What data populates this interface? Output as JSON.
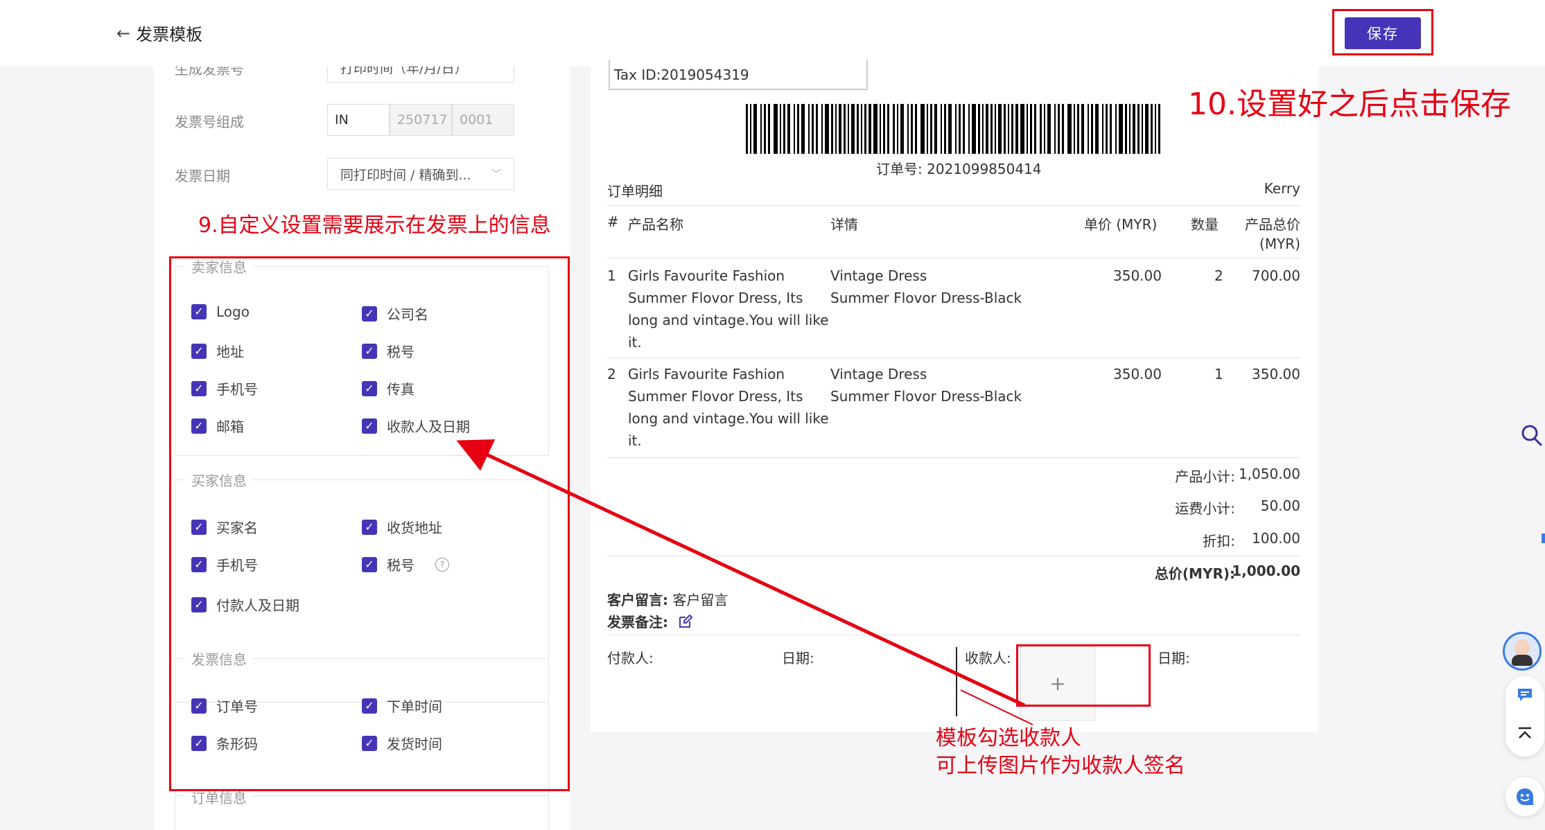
{
  "header": {
    "back_title": "发票模板",
    "save_label": "保存"
  },
  "left_panel": {
    "partial_top_label": "生成发票号",
    "partial_top_select": "打印时间（年/月/日）",
    "invoice_number_label": "发票号组成",
    "invoice_number_prefix": "IN",
    "invoice_number_date": "250717",
    "invoice_number_seq": "0001",
    "invoice_date_label": "发票日期",
    "invoice_date_select": "同打印时间 / 精确到...",
    "groups": [
      {
        "title": "卖家信息",
        "items": [
          {
            "label": "Logo",
            "checked": true
          },
          {
            "label": "公司名",
            "checked": true
          },
          {
            "label": "地址",
            "checked": true
          },
          {
            "label": "税号",
            "checked": true
          },
          {
            "label": "手机号",
            "checked": true
          },
          {
            "label": "传真",
            "checked": true
          },
          {
            "label": "邮箱",
            "checked": true
          },
          {
            "label": "收款人及日期",
            "checked": true
          }
        ]
      },
      {
        "title": "买家信息",
        "items": [
          {
            "label": "买家名",
            "checked": true
          },
          {
            "label": "收货地址",
            "checked": true
          },
          {
            "label": "手机号",
            "checked": true
          },
          {
            "label": "税号",
            "checked": true
          },
          {
            "label": "付款人及日期",
            "checked": true
          }
        ]
      },
      {
        "title": "发票信息",
        "items": [
          {
            "label": "订单号",
            "checked": true
          },
          {
            "label": "下单时间",
            "checked": true
          },
          {
            "label": "条形码",
            "checked": true
          },
          {
            "label": "发货时间",
            "checked": true
          }
        ]
      },
      {
        "title": "订单信息",
        "items": []
      }
    ]
  },
  "annotations": {
    "step9": "9.自定义设置需要展示在发票上的信息",
    "step10": "10.设置好之后点击保存",
    "payee_line1": "模板勾选收款人",
    "payee_line2": "可上传图片作为收款人签名"
  },
  "invoice": {
    "tax_id": "Tax ID:2019054319",
    "order_no": "订单号: 2021099850414",
    "section_title": "订单明细",
    "buyer_name": "Kerry",
    "columns": [
      "#",
      "产品名称",
      "详情",
      "单价 (MYR)",
      "数量",
      "产品总价",
      "(MYR)"
    ],
    "rows": [
      {
        "index": "1",
        "name_lines": [
          "Girls Favourite Fashion",
          "Summer Flovor Dress, Its",
          "long and vintage.You will like",
          "it."
        ],
        "detail_lines": [
          "Vintage Dress",
          "Summer Flovor Dress-Black"
        ],
        "unit_price": "350.00",
        "qty": "2",
        "total": "700.00"
      },
      {
        "index": "2",
        "name_lines": [
          "Girls Favourite Fashion",
          "Summer Flovor Dress, Its",
          "long and vintage.You will like",
          "it."
        ],
        "detail_lines": [
          "Vintage Dress",
          "Summer Flovor Dress-Black"
        ],
        "unit_price": "350.00",
        "qty": "1",
        "total": "350.00"
      }
    ],
    "summary": {
      "subtotal_label": "产品小计:",
      "subtotal": "1,050.00",
      "shipping_label": "运费小计:",
      "shipping": "50.00",
      "discount_label": "折扣:",
      "discount": "100.00",
      "grand_label": "总价(MYR):",
      "grand": "1,000.00"
    },
    "customer_note_label": "客户留言:",
    "customer_note": "客户留言",
    "invoice_remark_label": "发票备注:",
    "payer_label": "付款人:",
    "date_label": "日期:",
    "payee_label": "收款人:",
    "date_label2": "日期:",
    "upload_symbol": "+"
  },
  "colors": {
    "primary": "#4634b8",
    "annotation_red": "#e60012"
  }
}
